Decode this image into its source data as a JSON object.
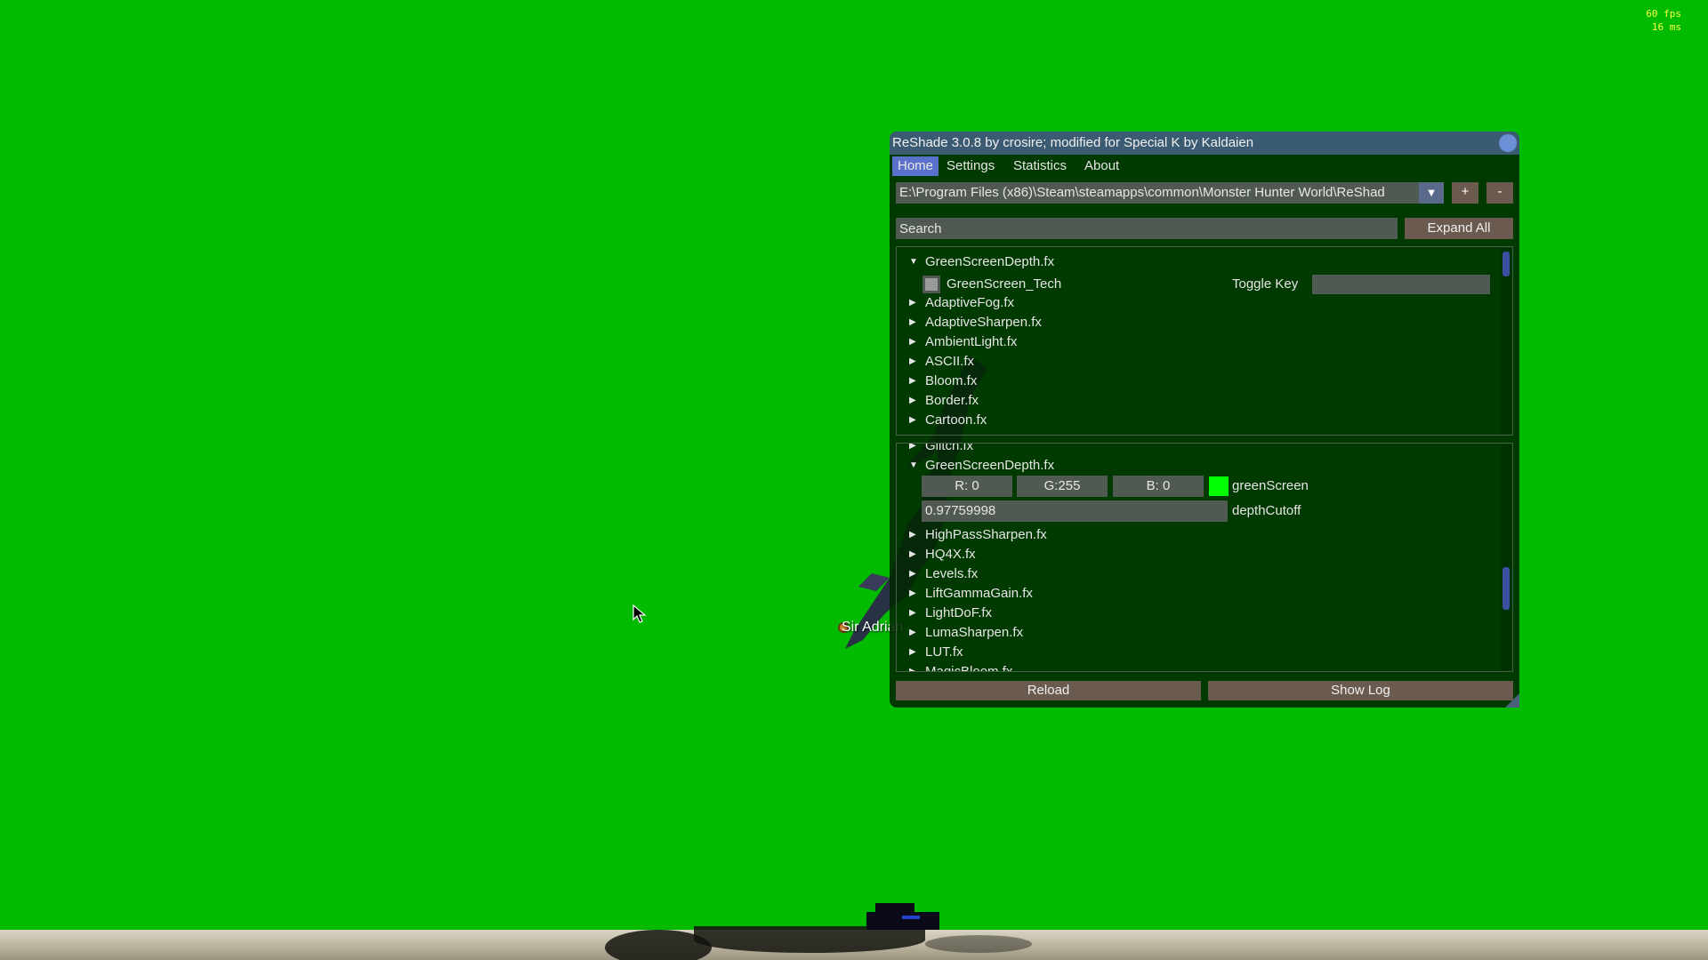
{
  "overlay": {
    "fps": "60 fps",
    "frame_time": "16 ms"
  },
  "scene": {
    "background_color": "#00bb00",
    "npc_label": "Sir Adrian"
  },
  "reshade": {
    "title": "ReShade 3.0.8 by crosire; modified for Special K by Kaldaien",
    "menu": [
      {
        "label": "Home",
        "active": true
      },
      {
        "label": "Settings",
        "active": false
      },
      {
        "label": "Statistics",
        "active": false
      },
      {
        "label": "About",
        "active": false
      }
    ],
    "preset_path": "E:\\Program Files (x86)\\Steam\\steamapps\\common\\Monster Hunter World\\ReShad",
    "add_label": "+",
    "remove_label": "-",
    "search_placeholder": "Search",
    "expand_all_label": "Expand All",
    "techniques": {
      "expanded_file": "GreenScreenDepth.fx",
      "technique_name": "GreenScreen_Tech",
      "technique_enabled": false,
      "toggle_key_label": "Toggle Key",
      "toggle_key_value": "",
      "files": [
        "AdaptiveFog.fx",
        "AdaptiveSharpen.fx",
        "AmbientLight.fx",
        "ASCII.fx",
        "Bloom.fx",
        "Border.fx",
        "Cartoon.fx"
      ]
    },
    "variables": {
      "partial_top": "Glitch.fx",
      "expanded_file": "GreenScreenDepth.fx",
      "color_r": "R:  0",
      "color_g": "G:255",
      "color_b": "B:  0",
      "color_swatch": "#00ff00",
      "color_name": "greenScreen",
      "depth_value": "0.97759998",
      "depth_name": "depthCutoff",
      "files": [
        "HighPassSharpen.fx",
        "HQ4X.fx",
        "Levels.fx",
        "LiftGammaGain.fx",
        "LightDoF.fx",
        "LumaSharpen.fx",
        "LUT.fx",
        "MagicBloom.fx"
      ]
    },
    "reload_label": "Reload",
    "show_log_label": "Show Log"
  }
}
